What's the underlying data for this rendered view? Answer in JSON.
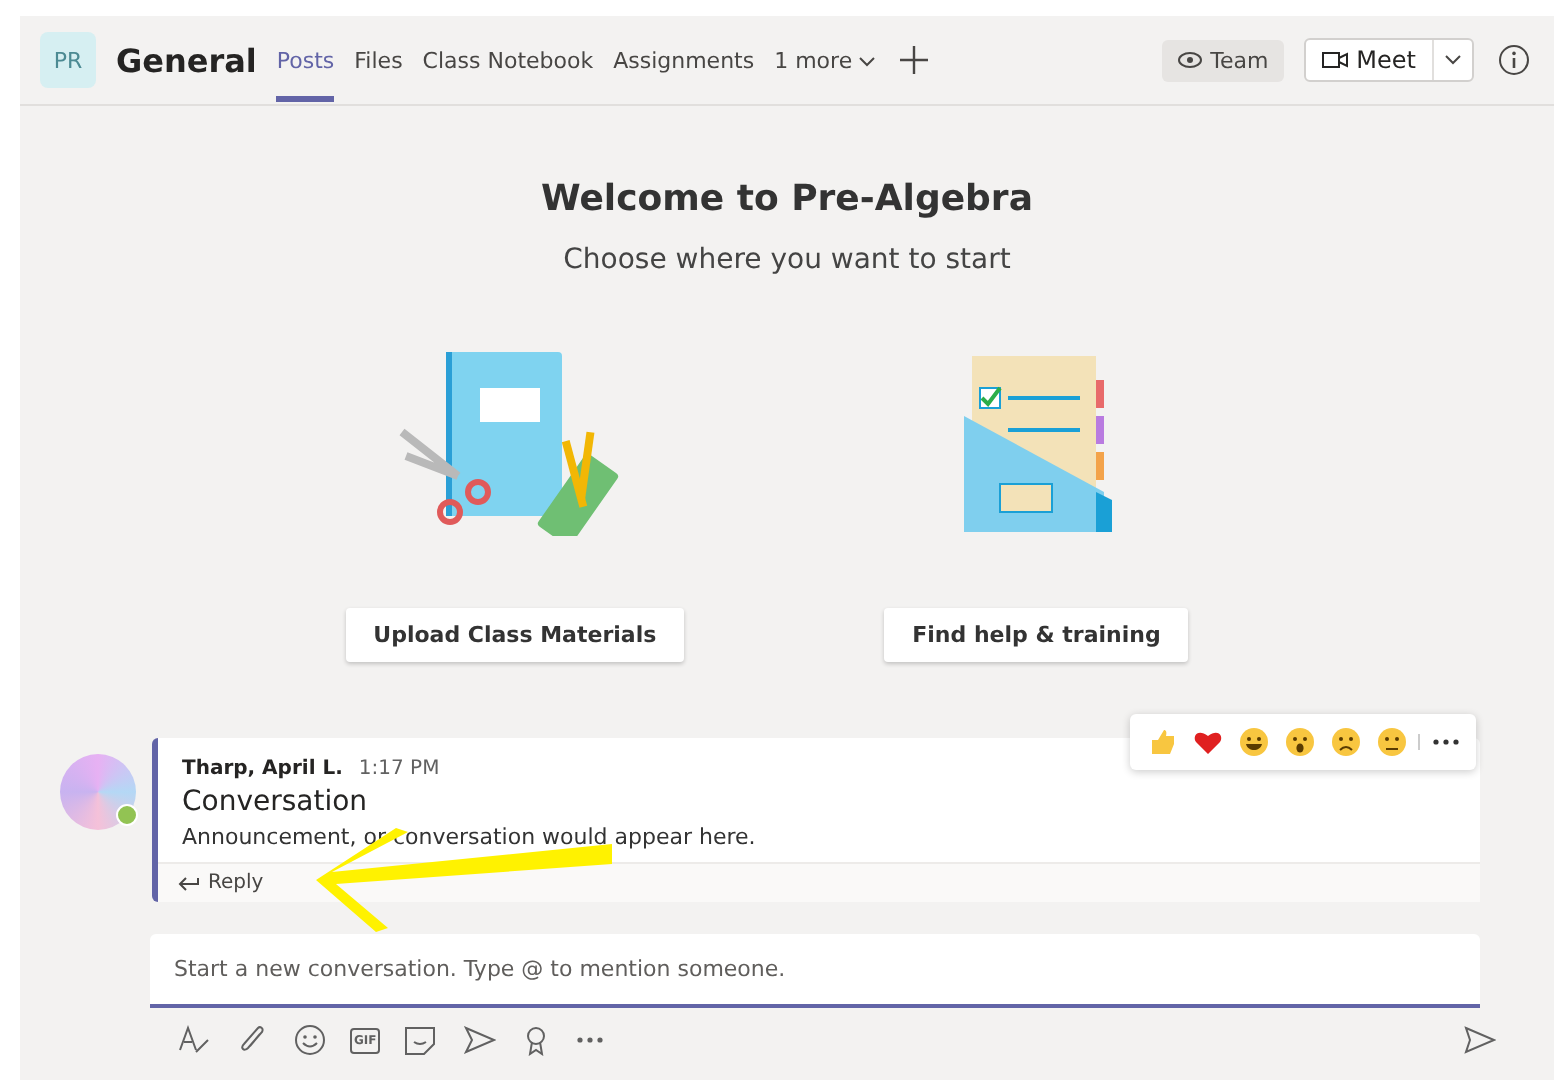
{
  "header": {
    "initials": "PR",
    "title": "General",
    "tabs": [
      {
        "label": "Posts",
        "selected": true
      },
      {
        "label": "Files",
        "selected": false
      },
      {
        "label": "Class Notebook",
        "selected": false
      },
      {
        "label": "Assignments",
        "selected": false
      }
    ],
    "more": "1 more",
    "team_button": "Team",
    "meet_button": "Meet"
  },
  "welcome": {
    "title": "Welcome to Pre-Algebra",
    "subtitle": "Choose where you want to start"
  },
  "actions": [
    {
      "kind": "upload",
      "label": "Upload Class Materials"
    },
    {
      "kind": "help",
      "label": "Find help & training"
    }
  ],
  "message": {
    "author": "Tharp, April L.",
    "time": "1:17 PM",
    "title": "Conversation",
    "body": "Announcement, or conversation would appear here.",
    "reply": "Reply"
  },
  "compose": {
    "placeholder": "Start a new conversation. Type @ to mention someone.",
    "gif_label": "GIF"
  }
}
